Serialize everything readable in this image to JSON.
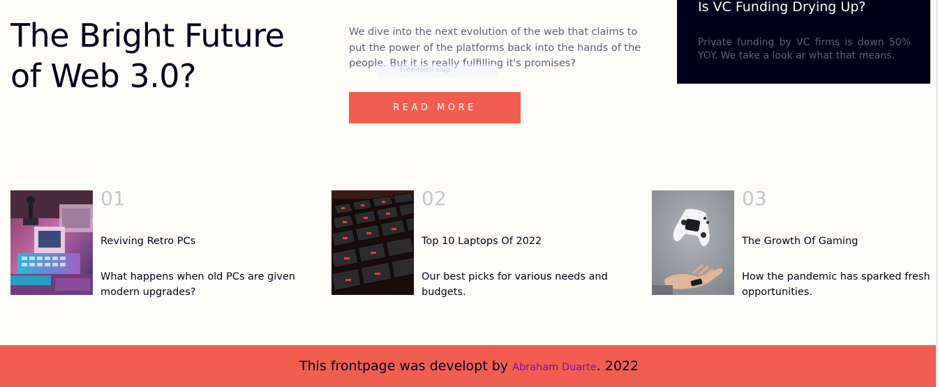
{
  "hero": {
    "title": "The Bright Future of Web 3.0?",
    "description": "We dive into the next evolution of the web that claims to put the power of the platforms back into the hands of the people. But it is really fulfilling it's promises?",
    "overlay_text": "Free-form snip",
    "button_label": "READ MORE"
  },
  "news_card": {
    "title": "Is VC Funding Drying Up?",
    "description": "Private funding by VC firms is down 50% YOY. We take a look ar what that means."
  },
  "articles": [
    {
      "number": "01",
      "title": "Reviving Retro PCs",
      "description": "What happens when old PCs are given modern upgrades?",
      "image_icon": "retro-pc-image"
    },
    {
      "number": "02",
      "title": "Top 10 Laptops Of 2022",
      "description": "Our best picks for various needs and budgets.",
      "image_icon": "laptop-keyboard-image"
    },
    {
      "number": "03",
      "title": "The Growth Of Gaming",
      "description": "How the pandemic has sparked fresh opportunities.",
      "image_icon": "game-controller-image"
    }
  ],
  "footer": {
    "prefix": "This frontpage was developt by ",
    "author": "Abraham Duarte",
    "suffix": ". 2022"
  },
  "colors": {
    "accent": "#f15e50",
    "dark": "#00001a",
    "background": "#fffdf9",
    "muted": "#5d5f79",
    "number": "#c5c6ce",
    "link": "#7a0fa3"
  }
}
